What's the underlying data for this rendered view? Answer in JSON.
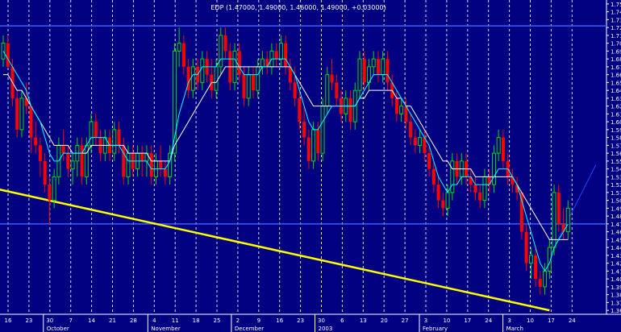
{
  "chart_data": {
    "type": "candlestick",
    "title": "EDP (1.47000, 1.49000, 1.46000, 1.49000, +0.03000)",
    "y_axis": {
      "min": 1.355,
      "max": 1.755,
      "tick_labels": [
        "1.75",
        "1.74",
        "1.73",
        "1.72",
        "1.71",
        "1.70",
        "1.69",
        "1.68",
        "1.67",
        "1.66",
        "1.65",
        "1.64",
        "1.63",
        "1.62",
        "1.61",
        "1.60",
        "1.59",
        "1.58",
        "1.57",
        "1.56",
        "1.55",
        "1.54",
        "1.53",
        "1.52",
        "1.51",
        "1.50",
        "1.49",
        "1.48",
        "1.47",
        "1.46",
        "1.45",
        "1.44",
        "1.43",
        "1.42",
        "1.41",
        "1.40",
        "1.39",
        "1.38",
        "1.37",
        "1.36"
      ]
    },
    "reference_lines": [
      1.722,
      1.47
    ],
    "x_axis": {
      "day_labels": [
        "16",
        "23",
        "30",
        "7",
        "14",
        "21",
        "28",
        "4",
        "11",
        "18",
        "25",
        "2",
        "9",
        "16",
        "23",
        "30",
        "6",
        "13",
        "20",
        "27",
        "3",
        "10",
        "17",
        "24",
        "3",
        "10",
        "17",
        "24"
      ],
      "month_labels": [
        "October",
        "November",
        "December",
        "2003",
        "February",
        "March"
      ]
    },
    "candles": [
      [
        1.68,
        1.71,
        1.67,
        1.7
      ],
      [
        1.7,
        1.71,
        1.67,
        1.67
      ],
      [
        1.67,
        1.68,
        1.62,
        1.63
      ],
      [
        1.63,
        1.64,
        1.58,
        1.59
      ],
      [
        1.59,
        1.64,
        1.58,
        1.63
      ],
      [
        1.63,
        1.65,
        1.61,
        1.62
      ],
      [
        1.62,
        1.62,
        1.56,
        1.58
      ],
      [
        1.58,
        1.6,
        1.56,
        1.57
      ],
      [
        1.57,
        1.58,
        1.53,
        1.55
      ],
      [
        1.55,
        1.56,
        1.51,
        1.52
      ],
      [
        1.52,
        1.53,
        1.47,
        1.5
      ],
      [
        1.5,
        1.54,
        1.49,
        1.53
      ],
      [
        1.53,
        1.58,
        1.52,
        1.57
      ],
      [
        1.57,
        1.59,
        1.55,
        1.56
      ],
      [
        1.56,
        1.57,
        1.53,
        1.54
      ],
      [
        1.54,
        1.56,
        1.52,
        1.55
      ],
      [
        1.55,
        1.58,
        1.53,
        1.57
      ],
      [
        1.57,
        1.58,
        1.52,
        1.53
      ],
      [
        1.53,
        1.58,
        1.52,
        1.57
      ],
      [
        1.57,
        1.61,
        1.56,
        1.6
      ],
      [
        1.6,
        1.61,
        1.57,
        1.58
      ],
      [
        1.58,
        1.59,
        1.55,
        1.56
      ],
      [
        1.56,
        1.59,
        1.55,
        1.58
      ],
      [
        1.58,
        1.59,
        1.55,
        1.56
      ],
      [
        1.56,
        1.6,
        1.55,
        1.59
      ],
      [
        1.59,
        1.6,
        1.56,
        1.57
      ],
      [
        1.57,
        1.58,
        1.52,
        1.53
      ],
      [
        1.53,
        1.57,
        1.52,
        1.56
      ],
      [
        1.56,
        1.57,
        1.53,
        1.54
      ],
      [
        1.54,
        1.57,
        1.53,
        1.56
      ],
      [
        1.56,
        1.57,
        1.53,
        1.55
      ],
      [
        1.55,
        1.57,
        1.53,
        1.56
      ],
      [
        1.56,
        1.57,
        1.52,
        1.53
      ],
      [
        1.53,
        1.56,
        1.52,
        1.55
      ],
      [
        1.55,
        1.57,
        1.53,
        1.54
      ],
      [
        1.54,
        1.55,
        1.52,
        1.53
      ],
      [
        1.53,
        1.57,
        1.52,
        1.56
      ],
      [
        1.56,
        1.7,
        1.55,
        1.69
      ],
      [
        1.69,
        1.72,
        1.67,
        1.7
      ],
      [
        1.7,
        1.71,
        1.66,
        1.67
      ],
      [
        1.67,
        1.68,
        1.63,
        1.64
      ],
      [
        1.64,
        1.68,
        1.63,
        1.67
      ],
      [
        1.67,
        1.68,
        1.64,
        1.65
      ],
      [
        1.65,
        1.69,
        1.64,
        1.68
      ],
      [
        1.68,
        1.69,
        1.65,
        1.66
      ],
      [
        1.66,
        1.68,
        1.63,
        1.64
      ],
      [
        1.64,
        1.68,
        1.63,
        1.67
      ],
      [
        1.67,
        1.72,
        1.66,
        1.71
      ],
      [
        1.71,
        1.72,
        1.68,
        1.69
      ],
      [
        1.69,
        1.7,
        1.64,
        1.65
      ],
      [
        1.65,
        1.7,
        1.64,
        1.69
      ],
      [
        1.69,
        1.7,
        1.65,
        1.66
      ],
      [
        1.66,
        1.67,
        1.62,
        1.63
      ],
      [
        1.63,
        1.67,
        1.62,
        1.66
      ],
      [
        1.66,
        1.67,
        1.63,
        1.64
      ],
      [
        1.64,
        1.68,
        1.63,
        1.67
      ],
      [
        1.67,
        1.69,
        1.66,
        1.68
      ],
      [
        1.68,
        1.69,
        1.66,
        1.67
      ],
      [
        1.67,
        1.7,
        1.66,
        1.69
      ],
      [
        1.69,
        1.7,
        1.67,
        1.68
      ],
      [
        1.68,
        1.71,
        1.67,
        1.7
      ],
      [
        1.7,
        1.71,
        1.66,
        1.67
      ],
      [
        1.67,
        1.68,
        1.64,
        1.65
      ],
      [
        1.65,
        1.67,
        1.62,
        1.63
      ],
      [
        1.63,
        1.64,
        1.59,
        1.6
      ],
      [
        1.6,
        1.62,
        1.57,
        1.58
      ],
      [
        1.58,
        1.59,
        1.54,
        1.55
      ],
      [
        1.55,
        1.6,
        1.54,
        1.59
      ],
      [
        1.59,
        1.6,
        1.55,
        1.56
      ],
      [
        1.56,
        1.63,
        1.55,
        1.62
      ],
      [
        1.62,
        1.67,
        1.61,
        1.66
      ],
      [
        1.66,
        1.68,
        1.64,
        1.65
      ],
      [
        1.65,
        1.66,
        1.62,
        1.63
      ],
      [
        1.63,
        1.64,
        1.6,
        1.61
      ],
      [
        1.61,
        1.64,
        1.6,
        1.63
      ],
      [
        1.63,
        1.64,
        1.59,
        1.6
      ],
      [
        1.6,
        1.65,
        1.59,
        1.64
      ],
      [
        1.64,
        1.69,
        1.63,
        1.68
      ],
      [
        1.68,
        1.69,
        1.64,
        1.65
      ],
      [
        1.65,
        1.68,
        1.64,
        1.67
      ],
      [
        1.67,
        1.69,
        1.66,
        1.68
      ],
      [
        1.68,
        1.69,
        1.65,
        1.66
      ],
      [
        1.66,
        1.69,
        1.65,
        1.68
      ],
      [
        1.68,
        1.69,
        1.64,
        1.65
      ],
      [
        1.65,
        1.66,
        1.62,
        1.63
      ],
      [
        1.63,
        1.64,
        1.6,
        1.61
      ],
      [
        1.61,
        1.63,
        1.6,
        1.62
      ],
      [
        1.62,
        1.63,
        1.59,
        1.6
      ],
      [
        1.6,
        1.61,
        1.57,
        1.58
      ],
      [
        1.58,
        1.59,
        1.56,
        1.57
      ],
      [
        1.57,
        1.59,
        1.56,
        1.58
      ],
      [
        1.58,
        1.59,
        1.55,
        1.56
      ],
      [
        1.56,
        1.57,
        1.53,
        1.54
      ],
      [
        1.54,
        1.55,
        1.51,
        1.52
      ],
      [
        1.52,
        1.53,
        1.49,
        1.5
      ],
      [
        1.5,
        1.51,
        1.48,
        1.49
      ],
      [
        1.49,
        1.52,
        1.48,
        1.51
      ],
      [
        1.51,
        1.56,
        1.5,
        1.55
      ],
      [
        1.55,
        1.56,
        1.52,
        1.53
      ],
      [
        1.53,
        1.56,
        1.52,
        1.55
      ],
      [
        1.55,
        1.56,
        1.52,
        1.53
      ],
      [
        1.53,
        1.54,
        1.51,
        1.52
      ],
      [
        1.52,
        1.53,
        1.5,
        1.51
      ],
      [
        1.51,
        1.52,
        1.49,
        1.5
      ],
      [
        1.5,
        1.54,
        1.49,
        1.53
      ],
      [
        1.53,
        1.54,
        1.51,
        1.52
      ],
      [
        1.52,
        1.57,
        1.51,
        1.56
      ],
      [
        1.56,
        1.59,
        1.55,
        1.58
      ],
      [
        1.58,
        1.59,
        1.54,
        1.55
      ],
      [
        1.55,
        1.56,
        1.52,
        1.53
      ],
      [
        1.53,
        1.54,
        1.51,
        1.52
      ],
      [
        1.52,
        1.53,
        1.5,
        1.51
      ],
      [
        1.51,
        1.5,
        1.45,
        1.46
      ],
      [
        1.46,
        1.47,
        1.41,
        1.42
      ],
      [
        1.42,
        1.44,
        1.4,
        1.43
      ],
      [
        1.43,
        1.44,
        1.39,
        1.4
      ],
      [
        1.4,
        1.41,
        1.38,
        1.39
      ],
      [
        1.39,
        1.42,
        1.38,
        1.41
      ],
      [
        1.41,
        1.45,
        1.4,
        1.44
      ],
      [
        1.44,
        1.52,
        1.43,
        1.51
      ],
      [
        1.51,
        1.52,
        1.46,
        1.47
      ],
      [
        1.47,
        1.49,
        1.45,
        1.46
      ],
      [
        1.46,
        1.5,
        1.45,
        1.49
      ]
    ],
    "moving_averages": [
      {
        "color": "#FFFFFF",
        "values": [
          1.66,
          1.66,
          1.65,
          1.64,
          1.64,
          1.63,
          1.62,
          1.61,
          1.6,
          1.59,
          1.58,
          1.57,
          1.57,
          1.57,
          1.57,
          1.56,
          1.56,
          1.56,
          1.56,
          1.57,
          1.57,
          1.57,
          1.57,
          1.57,
          1.57,
          1.57,
          1.57,
          1.56,
          1.56,
          1.56,
          1.56,
          1.56,
          1.55,
          1.55,
          1.55,
          1.55,
          1.55,
          1.57,
          1.58,
          1.59,
          1.6,
          1.61,
          1.62,
          1.63,
          1.64,
          1.65,
          1.65,
          1.66,
          1.67,
          1.67,
          1.67,
          1.67,
          1.67,
          1.67,
          1.67,
          1.67,
          1.67,
          1.67,
          1.67,
          1.67,
          1.67,
          1.67,
          1.67,
          1.66,
          1.65,
          1.64,
          1.63,
          1.62,
          1.62,
          1.62,
          1.62,
          1.62,
          1.62,
          1.62,
          1.62,
          1.62,
          1.62,
          1.63,
          1.63,
          1.64,
          1.64,
          1.64,
          1.64,
          1.64,
          1.64,
          1.63,
          1.63,
          1.62,
          1.62,
          1.61,
          1.6,
          1.59,
          1.58,
          1.57,
          1.56,
          1.55,
          1.55,
          1.54,
          1.54,
          1.54,
          1.54,
          1.54,
          1.53,
          1.53,
          1.53,
          1.53,
          1.53,
          1.53,
          1.53,
          1.53,
          1.53,
          1.52,
          1.51,
          1.5,
          1.49,
          1.48,
          1.47,
          1.46,
          1.45,
          1.45,
          1.45,
          1.45,
          1.45
        ]
      },
      {
        "color": "#00FFFF",
        "values": [
          1.69,
          1.68,
          1.67,
          1.66,
          1.65,
          1.64,
          1.62,
          1.61,
          1.6,
          1.58,
          1.56,
          1.55,
          1.55,
          1.56,
          1.56,
          1.56,
          1.56,
          1.56,
          1.57,
          1.58,
          1.58,
          1.58,
          1.58,
          1.57,
          1.57,
          1.57,
          1.56,
          1.55,
          1.55,
          1.55,
          1.55,
          1.55,
          1.54,
          1.54,
          1.54,
          1.54,
          1.55,
          1.58,
          1.61,
          1.63,
          1.65,
          1.66,
          1.66,
          1.67,
          1.67,
          1.67,
          1.67,
          1.68,
          1.68,
          1.68,
          1.68,
          1.67,
          1.66,
          1.66,
          1.66,
          1.66,
          1.67,
          1.67,
          1.68,
          1.68,
          1.68,
          1.68,
          1.67,
          1.66,
          1.64,
          1.62,
          1.6,
          1.59,
          1.59,
          1.6,
          1.61,
          1.62,
          1.62,
          1.62,
          1.62,
          1.62,
          1.62,
          1.63,
          1.64,
          1.65,
          1.66,
          1.66,
          1.66,
          1.66,
          1.65,
          1.64,
          1.63,
          1.62,
          1.61,
          1.6,
          1.59,
          1.58,
          1.57,
          1.55,
          1.53,
          1.52,
          1.51,
          1.52,
          1.52,
          1.53,
          1.53,
          1.53,
          1.52,
          1.52,
          1.52,
          1.52,
          1.53,
          1.54,
          1.54,
          1.54,
          1.53,
          1.52,
          1.5,
          1.48,
          1.46,
          1.44,
          1.42,
          1.41,
          1.42,
          1.44,
          1.45,
          1.46,
          1.47
        ]
      }
    ],
    "trendline": {
      "from": [
        0,
        1.515
      ],
      "to": [
        118,
        1.36
      ]
    },
    "projection_line": {
      "from": [
        119,
        1.44
      ],
      "to": [
        128,
        1.545
      ]
    }
  }
}
